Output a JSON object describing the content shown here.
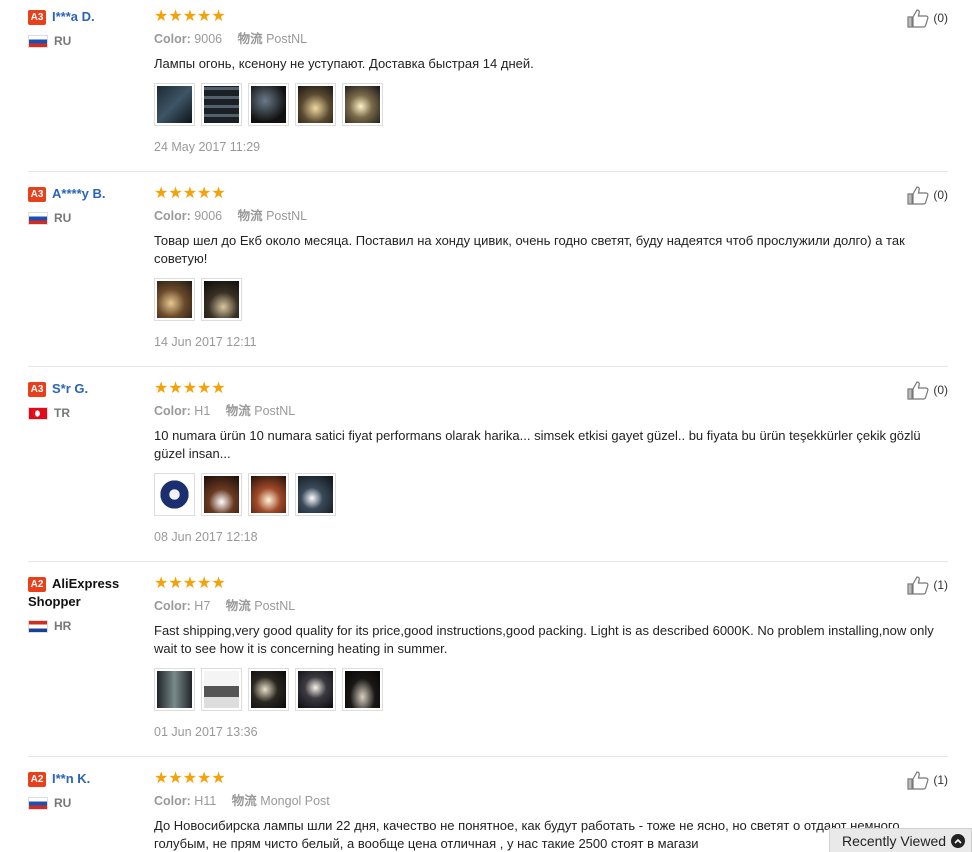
{
  "reviews": [
    {
      "level": "A3",
      "name": "I***a D.",
      "country": "RU",
      "stars": "★★★★★",
      "color_label": "Color:",
      "color": "9006",
      "shipping_label": "物流",
      "shipping": "PostNL",
      "text": "Лампы огонь, ксенону не уступают. Доставка быстрая 14 дней.",
      "date": "24 May 2017 11:29",
      "helpful": "(0)"
    },
    {
      "level": "A3",
      "name": "A****y B.",
      "country": "RU",
      "stars": "★★★★★",
      "color_label": "Color:",
      "color": "9006",
      "shipping_label": "物流",
      "shipping": "PostNL",
      "text": "Товар шел до Екб около месяца. Поставил на хонду цивик, очень годно светят, буду надеятся чтоб прослужили долго) а так советую!",
      "date": "14 Jun 2017 12:11",
      "helpful": "(0)"
    },
    {
      "level": "A3",
      "name": "S*r G.",
      "country": "TR",
      "stars": "★★★★★",
      "color_label": "Color:",
      "color": "H1",
      "shipping_label": "物流",
      "shipping": "PostNL",
      "text": "10 numara ürün 10 numara satici fiyat performans olarak harika... simsek etkisi gayet güzel.. bu fiyata bu ürün teşekkürler çekik gözlü güzel insan...",
      "date": "08 Jun 2017 12:18",
      "helpful": "(0)"
    },
    {
      "level": "A2",
      "name": "AliExpress Shopper",
      "country": "HR",
      "stars": "★★★★★",
      "color_label": "Color:",
      "color": "H7",
      "shipping_label": "物流",
      "shipping": "PostNL",
      "text": "Fast shipping,very good quality for its price,good instructions,good packing. Light is as described 6000K. No problem installing,now only wait to see how it is concerning heating in summer.",
      "date": "01 Jun 2017 13:36",
      "helpful": "(1)"
    },
    {
      "level": "A2",
      "name": "I**n K.",
      "country": "RU",
      "stars": "★★★★★",
      "color_label": "Color:",
      "color": "H11",
      "shipping_label": "物流",
      "shipping": "Mongol Post",
      "text": "До Новосибирска лампы шли 22 дня, качество не понятное, как будут работать - тоже не ясно, но светят о отдают немного голубым, не прям чисто белый, а вообще цена отличная , у нас такие 2500 стоят в магази",
      "date": "",
      "helpful": "(1)"
    }
  ],
  "recently_viewed": "Recently Viewed",
  "colors": {
    "accent_star": "#f5a20a",
    "badge": "#e8401a",
    "link": "#2a64b6"
  }
}
